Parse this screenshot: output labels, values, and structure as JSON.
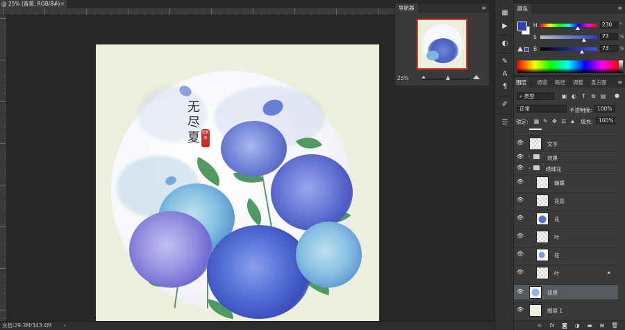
{
  "document": {
    "tab_title": "@ 25% (背景, RGB/8#)",
    "close_glyph": "×",
    "status_text": "文档:29.3M/343.4M",
    "status_arrow": "›",
    "canvas_bg_color": "#ecefdc"
  },
  "artwork": {
    "calligraphy": [
      "无",
      "尽",
      "夏"
    ],
    "seal_text": "留夏春"
  },
  "navigator": {
    "tab_label": "导航器",
    "zoom": "25%",
    "view_frame_color": "#e23c2c"
  },
  "tools": {
    "icons": [
      "swatches-grid-icon",
      "play-icon",
      "adjust-icon",
      "brush-settings-icon",
      "character-icon",
      "paragraph-icon",
      "brush-icon",
      "sliders-icon"
    ]
  },
  "color_panel": {
    "tab_label": "颜色",
    "foreground": "#3340bb",
    "background": "#ffffff",
    "h_label": "H",
    "s_label": "S",
    "b_label": "B",
    "h_value": "230",
    "s_value": "77",
    "b_value": "73",
    "h_unit": "°",
    "s_unit": "%",
    "b_unit": "%"
  },
  "layers_panel": {
    "tabs": [
      "图层",
      "通道",
      "路径",
      "调整",
      "直方图"
    ],
    "filter_kind": "类型",
    "blend_mode": "正常",
    "opacity_label": "不透明度:",
    "opacity_value": "100%",
    "lock_label": "锁定:",
    "fill_label": "填充:",
    "fill_value": "100%",
    "layers": [
      {
        "name": "文字",
        "type": "layer",
        "indent": 0
      },
      {
        "name": "效果",
        "type": "group",
        "expanded": false,
        "indent": 0
      },
      {
        "name": "绣球花",
        "type": "group",
        "expanded": true,
        "indent": 0
      },
      {
        "name": "蝴蝶",
        "type": "layer",
        "indent": 1
      },
      {
        "name": "花蕊",
        "type": "layer",
        "indent": 1
      },
      {
        "name": "花",
        "type": "layer",
        "indent": 1
      },
      {
        "name": "叶",
        "type": "layer",
        "indent": 1
      },
      {
        "name": "花",
        "type": "layer",
        "indent": 1
      },
      {
        "name": "叶",
        "type": "layer",
        "indent": 1,
        "locked": true
      },
      {
        "name": "背景",
        "type": "layer",
        "indent": 0,
        "selected": true
      },
      {
        "name": "图层 1",
        "type": "layer",
        "indent": 0
      }
    ],
    "bottom_icons": [
      "link-icon",
      "fx-icon",
      "mask-icon",
      "adjustment-icon",
      "folder-icon",
      "new-layer-icon",
      "trash-icon"
    ]
  }
}
